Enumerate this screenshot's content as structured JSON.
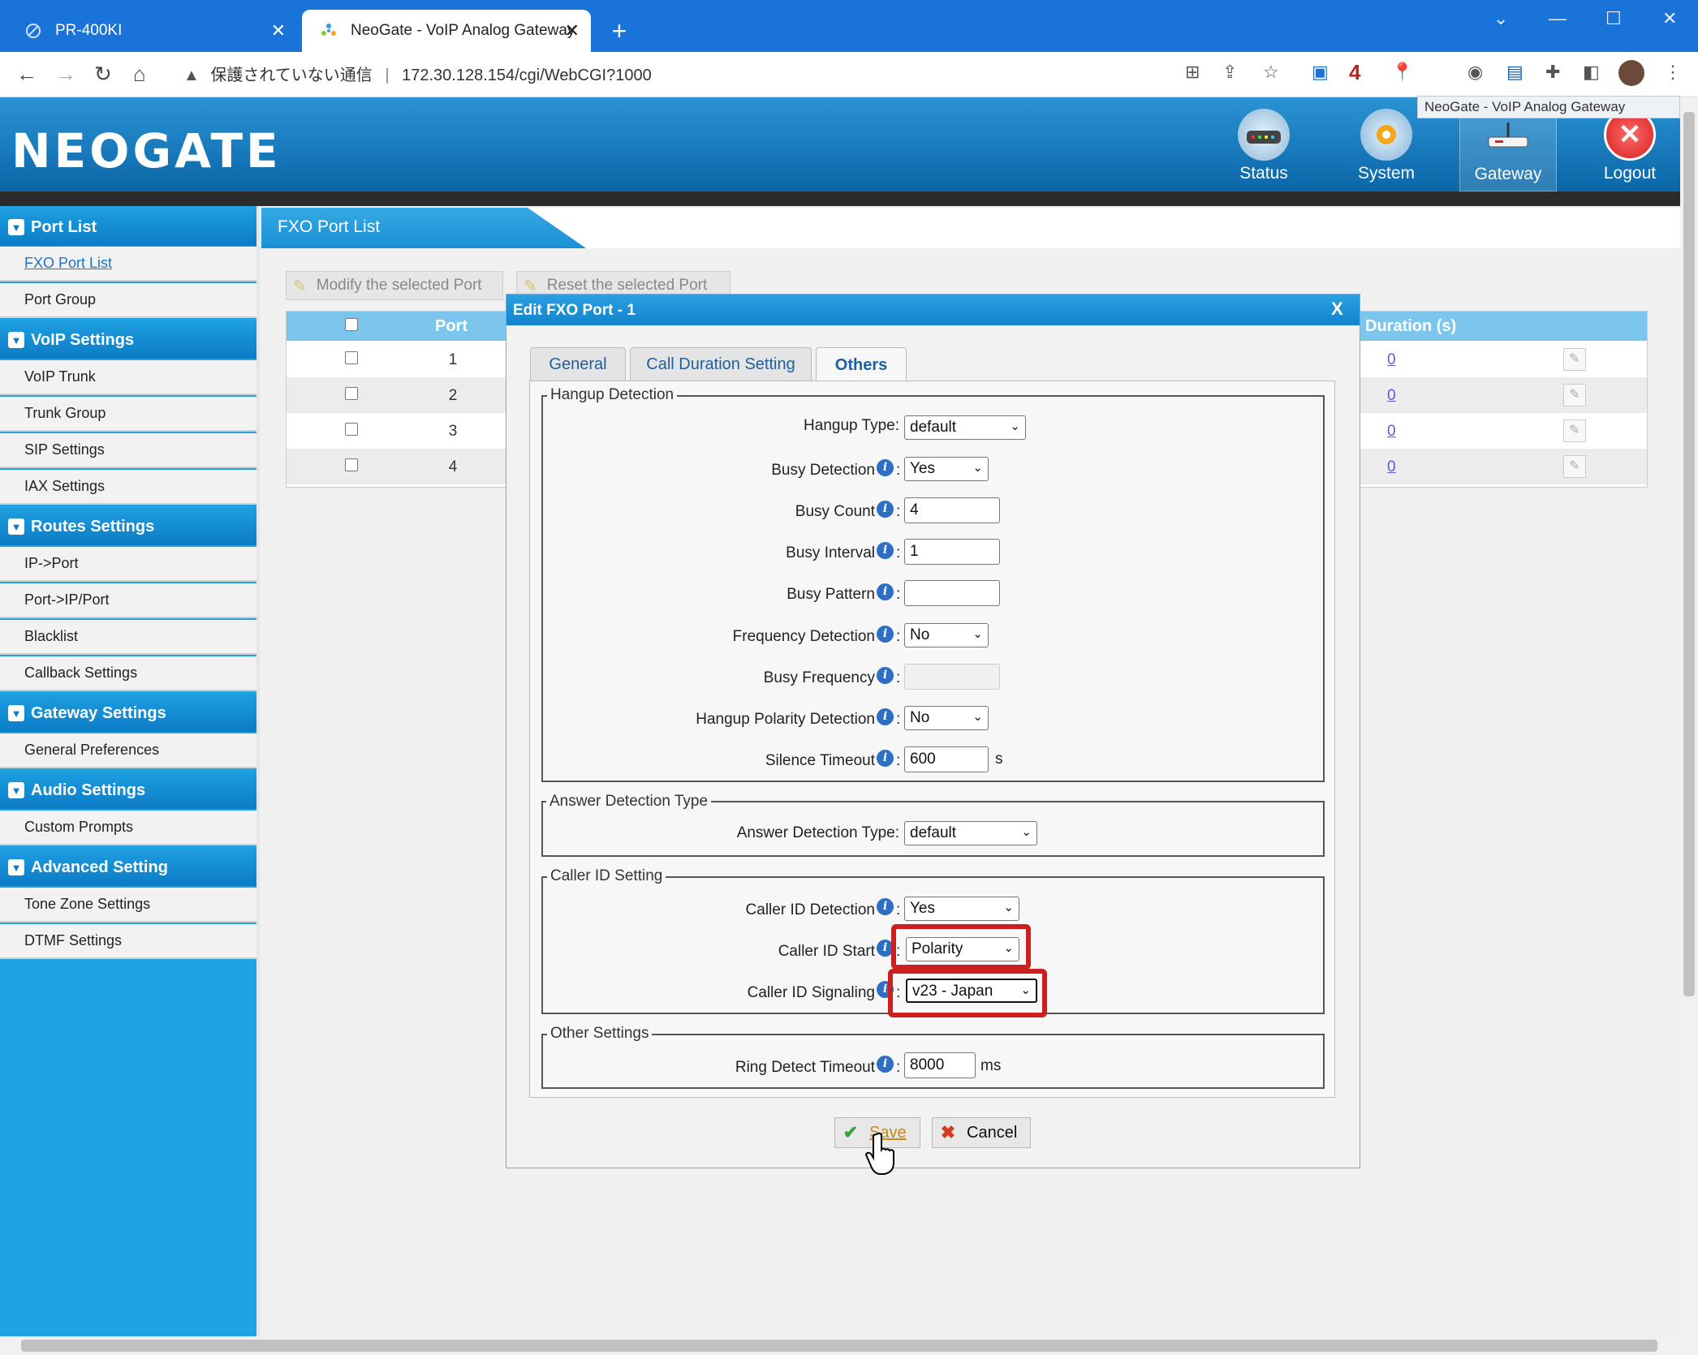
{
  "browser": {
    "tabs": [
      {
        "label": "PR-400KI",
        "close": "✕"
      },
      {
        "label": "NeoGate - VoIP Analog Gateway",
        "close": "✕"
      }
    ],
    "new_tab": "+",
    "window_controls": {
      "minimize": "—",
      "maximize": "☐",
      "close": "✕",
      "tabsearch": "⌄"
    },
    "url": {
      "security": "保護されていない通信",
      "address": "172.30.128.154/cgi/WebCGI?1000"
    },
    "badge_number": "4"
  },
  "header": {
    "logo": "NEOGATE",
    "nav": [
      {
        "label": "Status"
      },
      {
        "label": "System"
      },
      {
        "label": "Gateway"
      },
      {
        "label": "Logout"
      }
    ],
    "tooltip": "NeoGate - VoIP Analog Gateway"
  },
  "sidebar": {
    "sections": [
      {
        "title": "Port List",
        "items": [
          "FXO Port List",
          "Port Group"
        ]
      },
      {
        "title": "VoIP Settings",
        "items": [
          "VoIP Trunk",
          "Trunk Group",
          "SIP Settings",
          "IAX Settings"
        ]
      },
      {
        "title": "Routes Settings",
        "items": [
          "IP->Port",
          "Port->IP/Port",
          "Blacklist",
          "Callback Settings"
        ]
      },
      {
        "title": "Gateway Settings",
        "items": [
          "General Preferences"
        ]
      },
      {
        "title": "Audio Settings",
        "items": [
          "Custom Prompts"
        ]
      },
      {
        "title": "Advanced Setting",
        "items": [
          "Tone Zone Settings",
          "DTMF Settings"
        ]
      }
    ]
  },
  "content": {
    "title": "FXO Port List",
    "toolbar": {
      "modify": "Modify the selected Port",
      "reset": "Reset the selected Port"
    },
    "grid": {
      "col_port": "Port",
      "col_duration": "Duration (s)",
      "rows": [
        {
          "port": "1",
          "duration": "0"
        },
        {
          "port": "2",
          "duration": "0"
        },
        {
          "port": "3",
          "duration": "0"
        },
        {
          "port": "4",
          "duration": "0"
        }
      ]
    }
  },
  "dialog": {
    "title": "Edit FXO Port - 1",
    "close": "X",
    "tabs": [
      "General",
      "Call Duration Setting",
      "Others"
    ],
    "active_tab": "Others",
    "hangup": {
      "legend": "Hangup Detection",
      "hangup_type": {
        "label": "Hangup Type:",
        "value": "default"
      },
      "busy_detection": {
        "label": "Busy Detection",
        "value": "Yes"
      },
      "busy_count": {
        "label": "Busy Count",
        "value": "4"
      },
      "busy_interval": {
        "label": "Busy Interval",
        "value": "1"
      },
      "busy_pattern": {
        "label": "Busy Pattern",
        "value": ""
      },
      "frequency_detection": {
        "label": "Frequency Detection",
        "value": "No"
      },
      "busy_frequency": {
        "label": "Busy Frequency",
        "value": ""
      },
      "hangup_polarity": {
        "label": "Hangup Polarity Detection",
        "value": "No"
      },
      "silence_timeout": {
        "label": "Silence Timeout",
        "value": "600",
        "unit": "s"
      }
    },
    "answer": {
      "legend": "Answer Detection Type",
      "answer_type": {
        "label": "Answer Detection Type:",
        "value": "default"
      }
    },
    "callerid": {
      "legend": "Caller ID Setting",
      "detection": {
        "label": "Caller ID Detection",
        "value": "Yes"
      },
      "start": {
        "label": "Caller ID Start",
        "value": "Polarity"
      },
      "signaling": {
        "label": "Caller ID Signaling",
        "value": "v23 - Japan"
      }
    },
    "other": {
      "legend": "Other Settings",
      "ring_timeout": {
        "label": "Ring Detect Timeout",
        "value": "8000",
        "unit": "ms"
      }
    },
    "buttons": {
      "save": "Save",
      "cancel": "Cancel"
    }
  },
  "colors": {
    "highlight": "#cc1f1f",
    "brand_blue": "#1fa3e2"
  }
}
